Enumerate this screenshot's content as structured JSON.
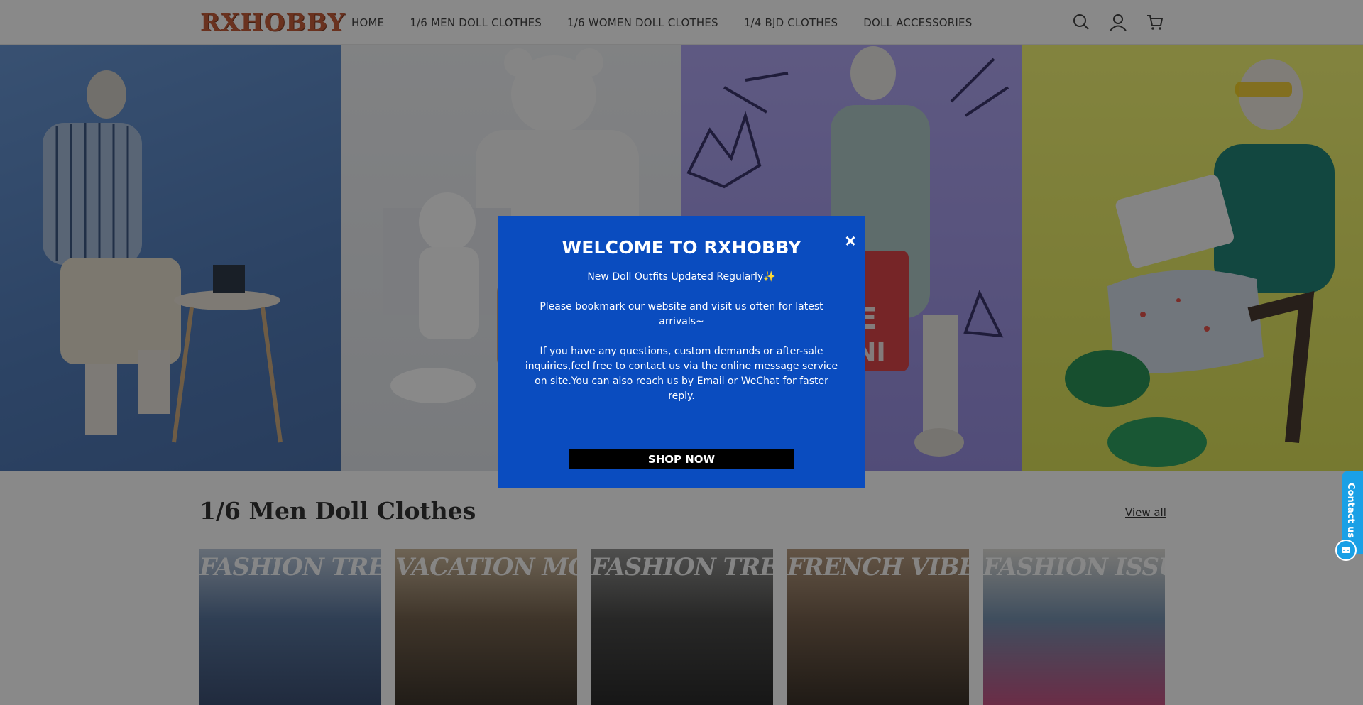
{
  "header": {
    "logo": "RXHOBBY",
    "nav": [
      "HOME",
      "1/6 MEN DOLL CLOTHES",
      "1/6 WOMEN DOLL CLOTHES",
      "1/4 BJD CLOTHES",
      "DOLL ACCESSORIES"
    ],
    "icons": [
      "search-icon",
      "account-icon",
      "cart-icon"
    ]
  },
  "hero": {
    "panels": [
      "striped-shirt-doll",
      "white-hoodie-doll",
      "jacket-bag-doll",
      "green-sweater-doll"
    ]
  },
  "section": {
    "title": "1/6 Men Doll Clothes",
    "view_all": "View all",
    "products": [
      {
        "banner": "FASHION TREND"
      },
      {
        "banner": "VACATION MODE"
      },
      {
        "banner": "FASHION TREND"
      },
      {
        "banner": "FRENCH VIBE"
      },
      {
        "banner": "FASHION ISSUE"
      }
    ]
  },
  "modal": {
    "title": "WELCOME TO RXHOBBY",
    "close": "×",
    "line1": "New Doll Outfits Updated Regularly✨",
    "line2": "Please bookmark our website and visit us often for latest arrivals~",
    "line3": "If you have any questions, custom demands or after-sale inquiries,feel free to contact us via the online message service on site.You can also reach us by Email or WeChat for faster reply.",
    "cta": "SHOP NOW"
  },
  "contact": {
    "label": "Contact us"
  },
  "colors": {
    "modal_bg": "#0a4cbf",
    "logo": "#c0512a",
    "contact": "#1aa0e6"
  }
}
